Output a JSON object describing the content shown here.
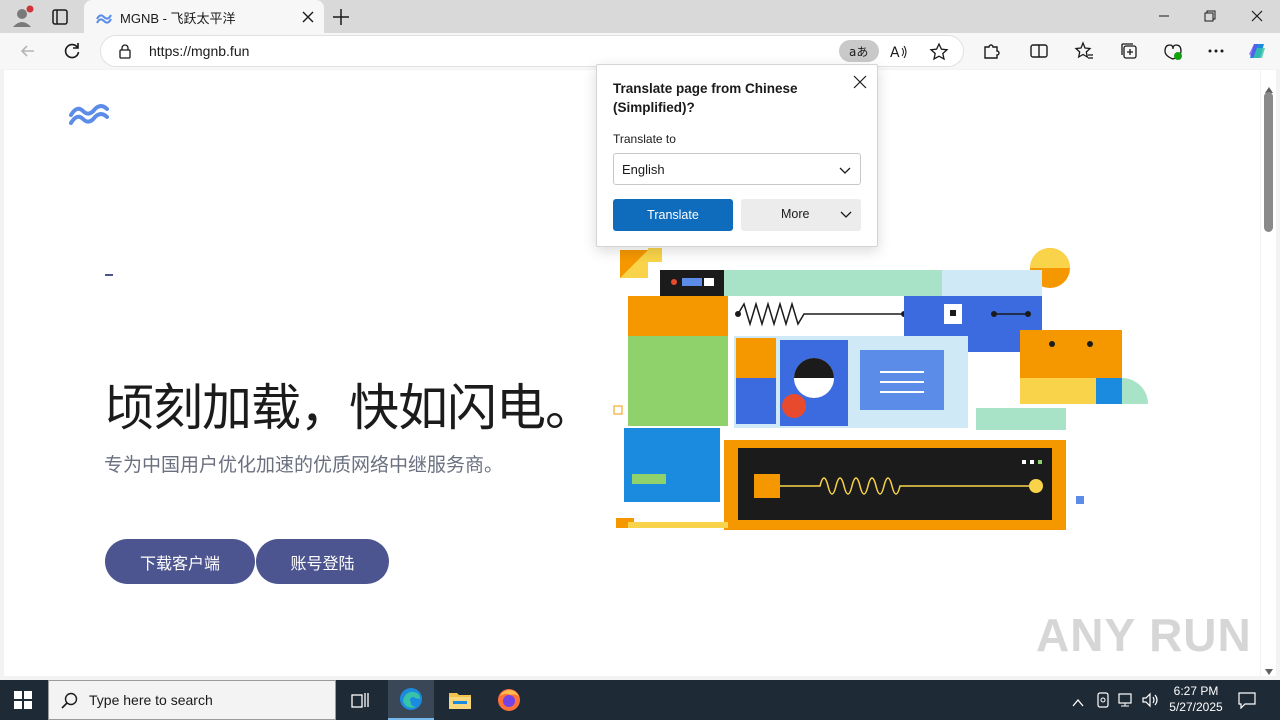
{
  "browser": {
    "tab_title": "MGNB - 飞跃太平洋",
    "url": "https://mgnb.fun"
  },
  "hero": {
    "headline": "顷刻加载，快如闪电。",
    "subline": "专为中国用户优化加速的优质网络中继服务商。",
    "buttons": [
      "下载客户端",
      "账号登陆"
    ]
  },
  "translate_popup": {
    "title": "Translate page from Chinese (Simplified)?",
    "label": "Translate to",
    "selected_language": "English",
    "translate_button": "Translate",
    "more_button": "More"
  },
  "taskbar": {
    "search_placeholder": "Type here to search",
    "time": "6:27 PM",
    "date": "5/27/2025"
  },
  "watermark": "ANY RUN",
  "colors": {
    "accent_button": "#4c558f",
    "translate_blue": "#0f6cbd",
    "taskbar": "#1f2a37"
  }
}
